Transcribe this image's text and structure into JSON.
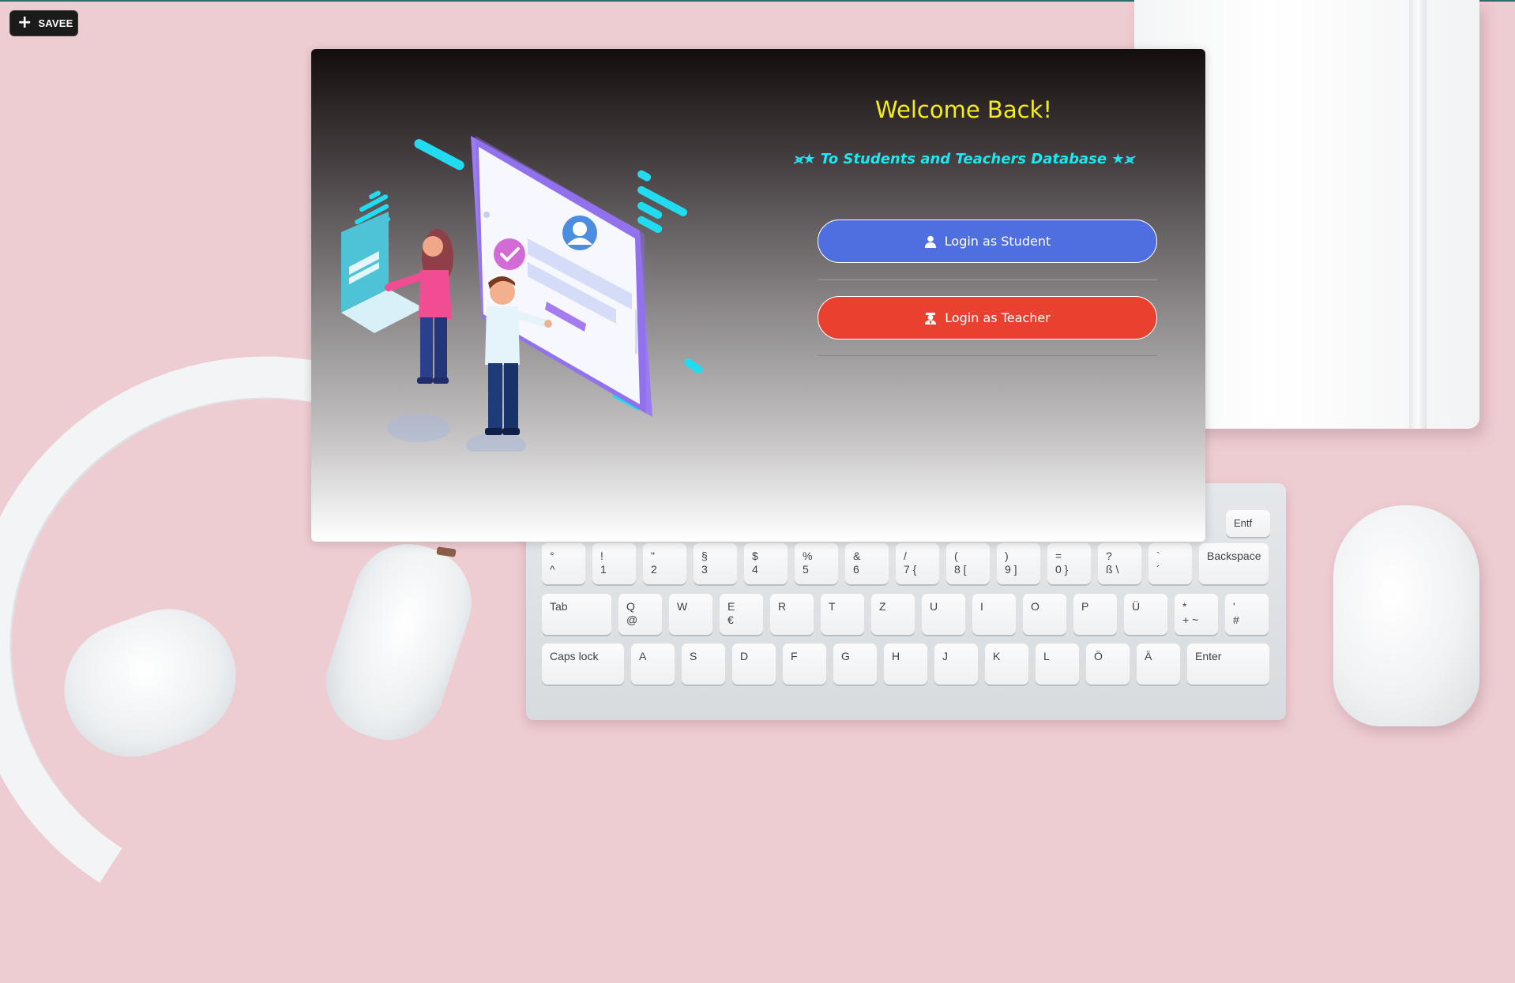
{
  "toolbar": {
    "save_label": "SAVEE",
    "save_icon": "plus-icon"
  },
  "card": {
    "title": "Welcome Back!",
    "subtitle": "⪤★ To Students and Teachers Database ★⪤",
    "student_button": {
      "label": "Login as Student",
      "icon": "user-icon"
    },
    "teacher_button": {
      "label": "Login as Teacher",
      "icon": "teacher-icon"
    }
  },
  "colors": {
    "title": "#f5ee14",
    "subtitle": "#1fe6f0",
    "student_button": "#4f6fe0",
    "teacher_button": "#e8412f"
  },
  "keyboard": {
    "number_row": [
      "°\n^",
      "!\n1",
      "\"\n2",
      "§\n3",
      "$\n4",
      "%\n5",
      "&\n6",
      "/\n7 {",
      "(\n8 [",
      ")\n9 ]",
      "=\n0 }",
      "?\nß \\",
      "`\n´",
      "Backspace"
    ],
    "top_row": [
      "Tab",
      "Q\n  @",
      "W",
      "E\n  €",
      "R",
      "T",
      "Z",
      "U",
      "I",
      "O",
      "P",
      "Ü",
      "*\n+ ~",
      "'\n#"
    ],
    "home_row": [
      "Caps lock",
      "A",
      "S",
      "D",
      "F",
      "G",
      "H",
      "J",
      "K",
      "L",
      "Ö",
      "Ä",
      "Enter"
    ],
    "corner_keys": [
      "Entf"
    ]
  }
}
